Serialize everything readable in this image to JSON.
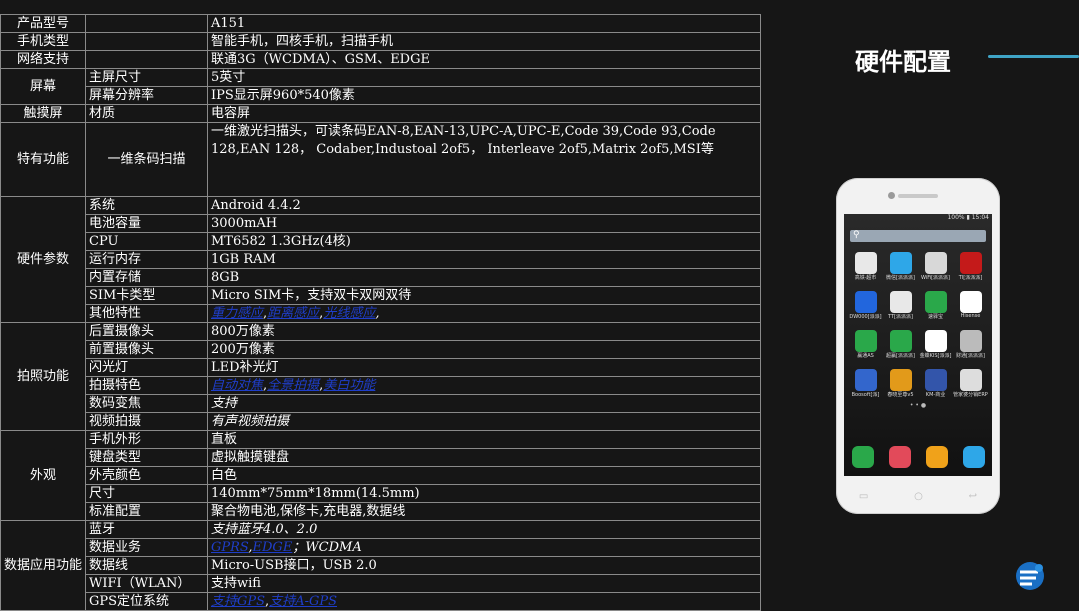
{
  "section_title": "硬件配置",
  "rows": [
    {
      "cat": "产品型号",
      "name": "",
      "value": "A151"
    },
    {
      "cat": "手机类型",
      "name": "",
      "value": "智能手机，四核手机，扫描手机"
    },
    {
      "cat": "网络支持",
      "name": "",
      "value": "联通3G（WCDMA）、GSM、EDGE"
    },
    {
      "cat": "屏幕",
      "items": [
        {
          "name": "主屏尺寸",
          "value": "5英寸"
        },
        {
          "name": "屏幕分辨率",
          "value": "IPS显示屏960*540像素"
        }
      ]
    },
    {
      "cat": "触摸屏",
      "name": "材质",
      "value": "电容屏"
    },
    {
      "cat": "特有功能",
      "name": "一维条码扫描",
      "value": "一维激光扫描头，可读条码EAN-8,EAN-13,UPC-A,UPC-E,Code 39,Code 93,Code 128,EAN 128， Codaber,Industoal 2of5， Interleave 2of5,Matrix 2of5,MSI等"
    },
    {
      "cat": "硬件参数",
      "items": [
        {
          "name": "系统",
          "value": "Android 4.4.2"
        },
        {
          "name": "电池容量",
          "value": "3000mAH"
        },
        {
          "name": "CPU",
          "value": "MT6582  1.3GHz(4核)"
        },
        {
          "name": "运行内存",
          "value": "1GB RAM"
        },
        {
          "name": "内置存储",
          "value": "8GB"
        },
        {
          "name": "SIM卡类型",
          "value": "Micro SIM卡，支持双卡双网双待"
        },
        {
          "name": "其他特性",
          "links": [
            "重力感应",
            "距离感应",
            "光线感应"
          ],
          "suffix": ","
        }
      ]
    },
    {
      "cat": "拍照功能",
      "items": [
        {
          "name": "后置摄像头",
          "value": "800万像素"
        },
        {
          "name": "前置摄像头",
          "value": "200万像素"
        },
        {
          "name": "闪光灯",
          "value": "LED补光灯"
        },
        {
          "name": "拍摄特色",
          "links": [
            "自动对焦",
            "全景拍摄",
            "美白功能"
          ],
          "suffix": ""
        },
        {
          "name": "数码变焦",
          "value": "支持"
        },
        {
          "name": "视频拍摄",
          "value": "有声视频拍摄"
        }
      ]
    },
    {
      "cat": "外观",
      "items": [
        {
          "name": "手机外形",
          "value": "直板"
        },
        {
          "name": "键盘类型",
          "value": "虚拟触摸键盘"
        },
        {
          "name": "外壳颜色",
          "value": "白色"
        },
        {
          "name": "尺寸",
          "value": "140mm*75mm*18mm(14.5mm)"
        },
        {
          "name": "标准配置",
          "value": "聚合物电池,保修卡,充电器,数据线"
        }
      ]
    },
    {
      "cat": "数据应用功能",
      "items": [
        {
          "name": "蓝牙",
          "value": "支持蓝牙4.0、2.0"
        },
        {
          "name": "数据业务",
          "links": [
            "GPRS",
            "EDGE"
          ],
          "suffix": "；WCDMA"
        },
        {
          "name": "数据线",
          "value": "Micro-USB接口，USB 2.0"
        },
        {
          "name": "WIFI（WLAN）",
          "value": "支持wifi"
        },
        {
          "name": "GPS定位系统",
          "links": [
            "支持GPS",
            "支持A-GPS"
          ],
          "suffix": ""
        }
      ]
    }
  ],
  "phone": {
    "status_text": "100% ▮ 15:04",
    "search_icon": "search-icon",
    "apps": [
      {
        "label": "高铁·超市",
        "color": "#e8e8e8"
      },
      {
        "label": "微信[派派派]",
        "color": "#2ea7e8"
      },
      {
        "label": "WiFi[派派派]",
        "color": "#d8d8d8"
      },
      {
        "label": "TI[派派派]",
        "color": "#c41a1a"
      },
      {
        "label": "DW000[派派]",
        "color": "#2266dd"
      },
      {
        "label": "TT[派派派]",
        "color": "#e8e8e8"
      },
      {
        "label": "速驿宝",
        "color": "#2aa84a"
      },
      {
        "label": "Hisense",
        "color": "#ffffff"
      },
      {
        "label": "赢通AS",
        "color": "#2aa84a"
      },
      {
        "label": "超赢[派派派]",
        "color": "#2aa84a"
      },
      {
        "label": "金蝶KIS[派派]",
        "color": "#ffffff"
      },
      {
        "label": "财通[派派派]",
        "color": "#bbbbbb"
      },
      {
        "label": "Boosoft[派]",
        "color": "#3366cc"
      },
      {
        "label": "春晓至尊v5",
        "color": "#e29a1a"
      },
      {
        "label": "KM-商业",
        "color": "#3355aa"
      },
      {
        "label": "管家婆分销ERP",
        "color": "#dddddd"
      }
    ],
    "dock": [
      "#2aa84a",
      "#e24a5a",
      "#f0a21a",
      "#2ea7e8"
    ]
  }
}
